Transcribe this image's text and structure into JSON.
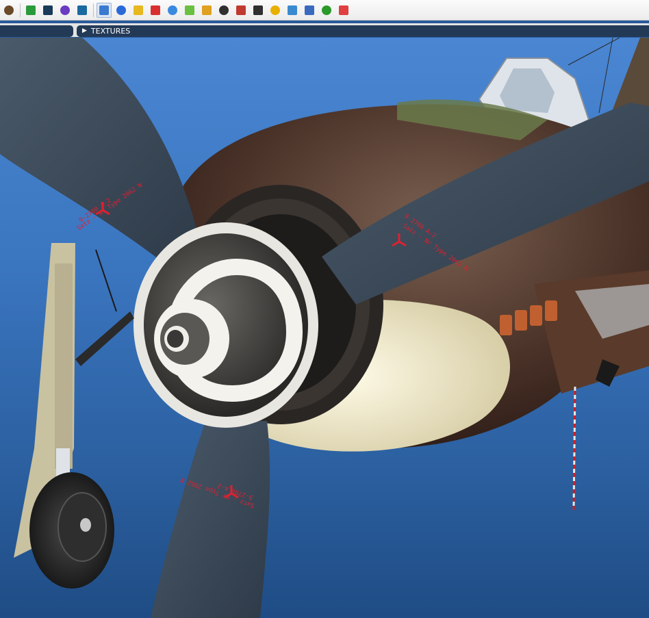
{
  "toolbar": {
    "buttons": [
      {
        "name": "viewer-logo-icon",
        "color": "#6b4a2a"
      },
      {
        "name": "rgb-channels-icon",
        "color": "#2a9a3a"
      },
      {
        "name": "film-strip-icon",
        "color": "#1a3a5a"
      },
      {
        "name": "undo-icon",
        "color": "#6a3ac0"
      },
      {
        "name": "screenshot-icon",
        "color": "#1a6aa0"
      },
      {
        "name": "statistics-icon",
        "color": "#3a7ad0",
        "active": true
      },
      {
        "name": "blue-cube-icon",
        "color": "#2a6ad8"
      },
      {
        "name": "copy-icon",
        "color": "#e8b820"
      },
      {
        "name": "red-cube-icon",
        "color": "#d83030"
      },
      {
        "name": "blue-box-icon",
        "color": "#3a8ae0"
      },
      {
        "name": "green-box-icon",
        "color": "#6ac040"
      },
      {
        "name": "axes-icon",
        "color": "#e0a020"
      },
      {
        "name": "bone-icon",
        "color": "#303030"
      },
      {
        "name": "skeleton-icon",
        "color": "#c03a30"
      },
      {
        "name": "camera-rig-icon",
        "color": "#303030"
      },
      {
        "name": "shell-icon",
        "color": "#e8b000"
      },
      {
        "name": "normals-icon",
        "color": "#3a8ad0"
      },
      {
        "name": "grid-icon",
        "color": "#3a6ac0"
      },
      {
        "name": "dot-grid-icon",
        "color": "#2a9a2a"
      },
      {
        "name": "target-icon",
        "color": "#e04040"
      }
    ]
  },
  "panels": {
    "textures_label": "TEXTURES"
  },
  "colors": {
    "panel_bg": "#233a57",
    "sky_top": "#4a86d2",
    "sky_bottom": "#1f4c84",
    "propeller": "#3a4a5a",
    "marking_red": "#e02030"
  },
  "scene": {
    "blade_markings": [
      "9-2700 A-2",
      "Satz - Nr Type 2062 N"
    ]
  }
}
